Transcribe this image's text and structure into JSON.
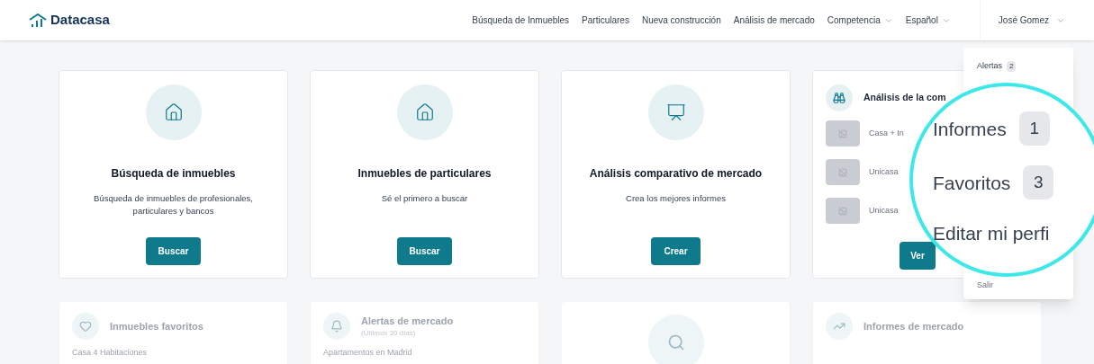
{
  "header": {
    "logo": "Datacasa",
    "nav": [
      {
        "label": "Búsqueda de Inmuebles",
        "has_menu": false
      },
      {
        "label": "Particulares",
        "has_menu": false
      },
      {
        "label": "Nueva construcción",
        "has_menu": false
      },
      {
        "label": "Análisis de mercado",
        "has_menu": false
      },
      {
        "label": "Competencia",
        "has_menu": true
      },
      {
        "label": "Español",
        "has_menu": true
      }
    ],
    "user": "José Gomez"
  },
  "cards": [
    {
      "kind": "house",
      "title": "Búsqueda de inmuebles",
      "text": "Búsqueda de inmuebles de profesionales, particulares y bancos",
      "button": "Buscar"
    },
    {
      "kind": "house",
      "title": "Inmuebles de particulares",
      "text": "Sé el primero a buscar",
      "button": "Buscar"
    },
    {
      "kind": "presentation",
      "title": "Análisis comparativo de mercado",
      "text": "Crea los mejores informes",
      "button": "Crear"
    }
  ],
  "competition_card": {
    "title": "Análisis de la com",
    "items": [
      "Casa + In",
      "Unicasa",
      "Unicasa"
    ],
    "button": "Ver"
  },
  "bottom_cards": [
    {
      "kind": "heart",
      "title": "Inmuebles favoritos",
      "item": "Casa 4 Habitaciones"
    },
    {
      "kind": "bell",
      "title": "Alertas de mercado",
      "subtitle": "(Últimos 30 días)",
      "item": "Apartamentos en Madrid"
    },
    {
      "kind": "search"
    },
    {
      "kind": "chart",
      "title": "Informes de mercado"
    }
  ],
  "user_menu": {
    "top": [
      {
        "label": "Alertas",
        "count": "2"
      }
    ],
    "bottom": [
      {
        "label": "Salir"
      }
    ]
  },
  "magnifier": {
    "items": [
      {
        "label": "Informes",
        "count": "1"
      },
      {
        "label": "Favoritos",
        "count": "3"
      },
      {
        "label": "Editar mi perfi"
      }
    ]
  }
}
